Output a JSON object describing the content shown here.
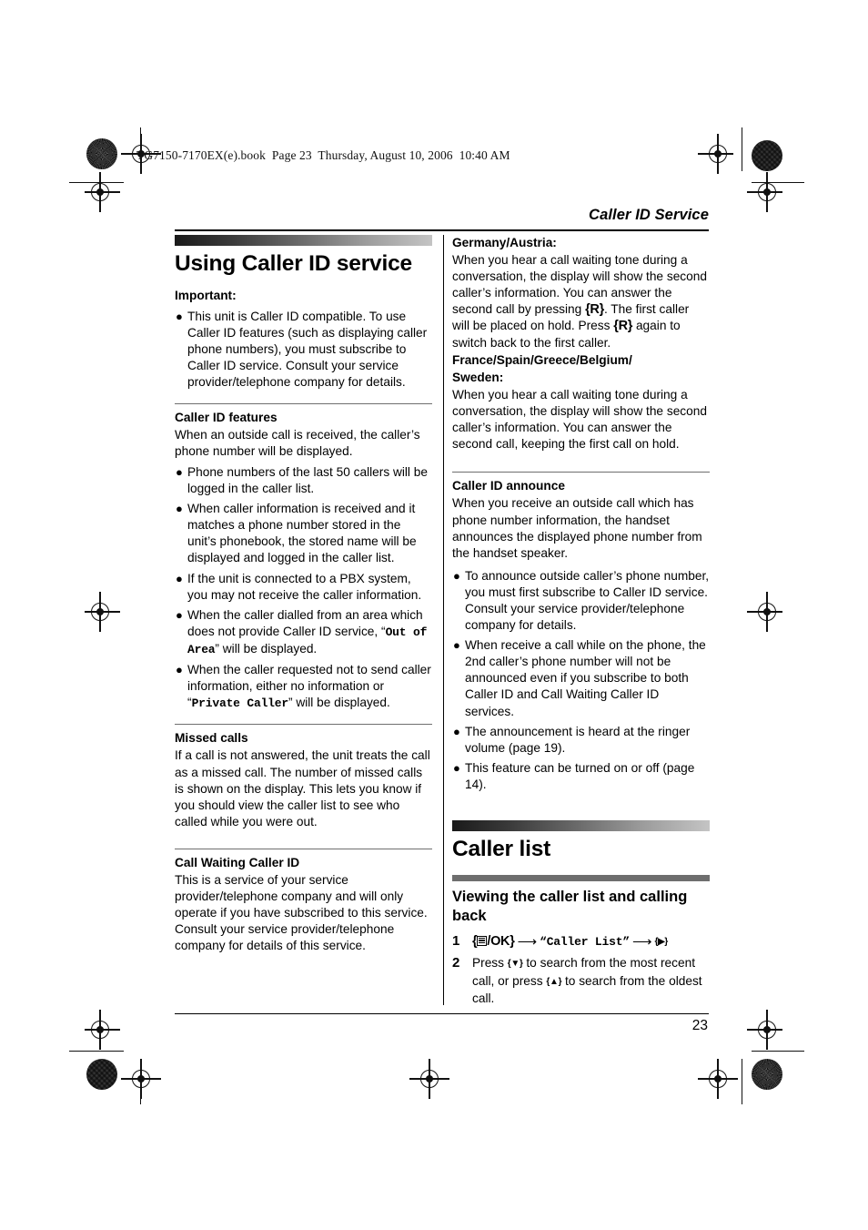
{
  "print_marks": {
    "book_line": "TG7150-7170EX(e).book  Page 23  Thursday, August 10, 2006  10:40 AM"
  },
  "header": {
    "running_head": "Caller ID Service"
  },
  "footer": {
    "page_number": "23"
  },
  "left_column": {
    "section_title": "Using Caller ID service",
    "important": {
      "heading": "Important:",
      "bullets": [
        "This unit is Caller ID compatible. To use Caller ID features (such as displaying caller phone numbers), you must subscribe to Caller ID service. Consult your service provider/telephone company for details."
      ]
    },
    "caller_id_features": {
      "heading": "Caller ID features",
      "intro": "When an outside call is received, the caller’s phone number will be displayed.",
      "bullets": [
        "Phone numbers of the last 50 callers will be logged in the caller list.",
        "When caller information is received and it matches a phone number stored in the unit’s phonebook, the stored name will be displayed and logged in the caller list.",
        "If the unit is connected to a PBX system, you may not receive the caller information."
      ],
      "bullet4_pre": "When the caller dialled from an area which does not provide Caller ID service, “",
      "bullet4_mono": "Out of Area",
      "bullet4_post": "” will be displayed.",
      "bullet5_pre": "When the caller requested not to send caller information, either no information or “",
      "bullet5_mono": "Private Caller",
      "bullet5_post": "” will be displayed."
    },
    "missed_calls": {
      "heading": "Missed calls",
      "body": "If a call is not answered, the unit treats the call as a missed call. The number of missed calls is shown on the display. This lets you know if you should view the caller list to see who called while you were out."
    },
    "call_waiting_caller_id": {
      "heading": "Call Waiting Caller ID",
      "body": "This is a service of your service provider/telephone company and will only operate if you have subscribed to this service. Consult your service provider/telephone company for details of this service."
    }
  },
  "right_column": {
    "germany_austria": {
      "heading": "Germany/Austria:",
      "part1": "When you hear a call waiting tone during a conversation, the display will show the second caller’s information. You can answer the second call by pressing ",
      "key1": "{R}",
      "part2": ". The first caller will be placed on hold. Press ",
      "key2": "{R}",
      "part3": " again to switch back to the first caller."
    },
    "france_group": {
      "heading_line1": "France/Spain/Greece/Belgium/",
      "heading_line2": "Sweden:",
      "body": "When you hear a call waiting tone during a conversation, the display will show the second caller’s information. You can answer the second call, keeping the first call on hold."
    },
    "caller_id_announce": {
      "heading": "Caller ID announce",
      "intro": "When you receive an outside call which has phone number information, the handset announces the displayed phone number from the handset speaker.",
      "bullets": [
        "To announce outside caller’s phone number, you must first subscribe to Caller ID service. Consult your service provider/telephone company for details.",
        "When receive a call while on the phone, the 2nd caller’s phone number will not be announced even if you subscribe to both Caller ID and Call Waiting Caller ID services.",
        "The announcement is heard at the ringer volume (page 19).",
        "This feature can be turned on or off (page 14)."
      ]
    },
    "caller_list": {
      "section_title": "Caller list",
      "subsection_title": "Viewing the caller list and calling back",
      "steps": [
        {
          "number": "1",
          "open_bracket": "{",
          "icon": "menu-icon",
          "ok_label": "/OK}",
          "arrow1": "⟶",
          "quote_open": "“",
          "menu_item": "Caller List",
          "quote_close": "”",
          "arrow2": "⟶",
          "right_key": "{▶}"
        },
        {
          "number": "2",
          "pre": "Press ",
          "down_key": "{▼}",
          "mid": " to search from the most recent call, or press ",
          "up_key": "{▲}",
          "post": " to search from the oldest call."
        }
      ]
    }
  },
  "icons": {
    "bullet": "●",
    "registration_mark": "registration-target",
    "halftone_circle": "halftone-dot-circle"
  },
  "colors": {
    "text": "#000000",
    "rule": "#6f6f6f",
    "subbar": "#6e6e6e",
    "gradient_start": "#1a1a1a",
    "gradient_end": "#c4c4c4"
  }
}
